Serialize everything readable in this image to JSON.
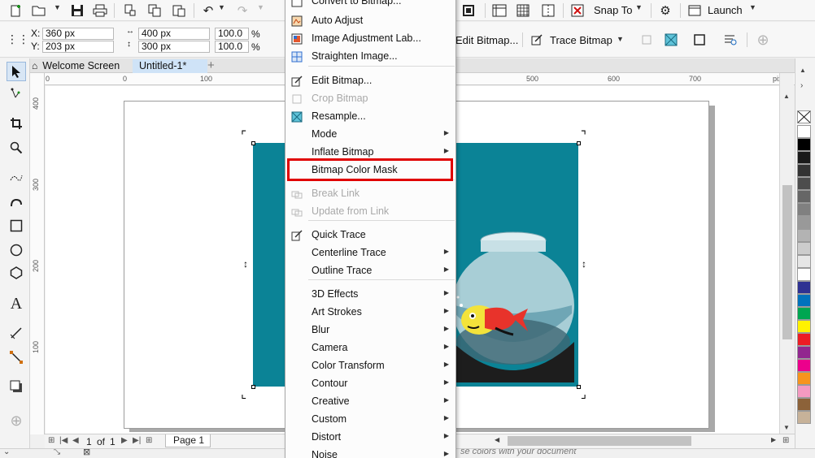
{
  "toolbar": {
    "snap_label": "Snap To",
    "launch_label": "Launch"
  },
  "property_bar": {
    "x_label": "X:",
    "x_value": "360 px",
    "y_label": "Y:",
    "y_value": "203 px",
    "width_value": "400 px",
    "height_value": "300 px",
    "scale_x": "100.0",
    "scale_y": "100.0",
    "percent": "%",
    "edit_bitmap_label": "Edit Bitmap...",
    "trace_bitmap_label": "Trace Bitmap"
  },
  "tabs": [
    {
      "label": "Welcome Screen"
    },
    {
      "label": "Untitled-1*"
    }
  ],
  "ruler": {
    "units": "pixels",
    "h_ticks": [
      "0",
      "0",
      "100",
      "500",
      "600",
      "700"
    ],
    "v_ticks": [
      "400",
      "300",
      "200",
      "100"
    ]
  },
  "menu": {
    "items": [
      {
        "label": "Convert to Bitmap...",
        "disabled": false,
        "submenu": false,
        "icon": "convert-bitmap-icon"
      },
      {
        "label": "Auto Adjust",
        "disabled": false,
        "submenu": false,
        "icon": "auto-adjust-icon"
      },
      {
        "label": "Image Adjustment Lab...",
        "disabled": false,
        "submenu": false,
        "icon": "image-adjustment-icon"
      },
      {
        "label": "Straighten Image...",
        "disabled": false,
        "submenu": false,
        "icon": "straighten-icon"
      },
      {
        "label": "Edit Bitmap...",
        "disabled": false,
        "submenu": false,
        "icon": "edit-bitmap-icon"
      },
      {
        "label": "Crop Bitmap",
        "disabled": true,
        "submenu": false,
        "icon": "crop-bitmap-icon"
      },
      {
        "label": "Resample...",
        "disabled": false,
        "submenu": false,
        "icon": "resample-icon"
      },
      {
        "label": "Mode",
        "disabled": false,
        "submenu": true,
        "icon": ""
      },
      {
        "label": "Inflate Bitmap",
        "disabled": false,
        "submenu": true,
        "icon": ""
      },
      {
        "label": "Bitmap Color Mask",
        "disabled": false,
        "submenu": false,
        "icon": ""
      },
      {
        "label": "Break Link",
        "disabled": true,
        "submenu": false,
        "icon": "break-link-icon"
      },
      {
        "label": "Update from Link",
        "disabled": true,
        "submenu": false,
        "icon": "update-link-icon"
      },
      {
        "label": "Quick Trace",
        "disabled": false,
        "submenu": false,
        "icon": "quick-trace-icon"
      },
      {
        "label": "Centerline Trace",
        "disabled": false,
        "submenu": true,
        "icon": ""
      },
      {
        "label": "Outline Trace",
        "disabled": false,
        "submenu": true,
        "icon": ""
      },
      {
        "label": "3D Effects",
        "disabled": false,
        "submenu": true,
        "icon": ""
      },
      {
        "label": "Art Strokes",
        "disabled": false,
        "submenu": true,
        "icon": ""
      },
      {
        "label": "Blur",
        "disabled": false,
        "submenu": true,
        "icon": ""
      },
      {
        "label": "Camera",
        "disabled": false,
        "submenu": true,
        "icon": ""
      },
      {
        "label": "Color Transform",
        "disabled": false,
        "submenu": true,
        "icon": ""
      },
      {
        "label": "Contour",
        "disabled": false,
        "submenu": true,
        "icon": ""
      },
      {
        "label": "Creative",
        "disabled": false,
        "submenu": true,
        "icon": ""
      },
      {
        "label": "Custom",
        "disabled": false,
        "submenu": true,
        "icon": ""
      },
      {
        "label": "Distort",
        "disabled": false,
        "submenu": true,
        "icon": ""
      },
      {
        "label": "Noise",
        "disabled": false,
        "submenu": true,
        "icon": ""
      }
    ],
    "highlighted": "Bitmap Color Mask"
  },
  "page_nav": {
    "current": "1",
    "of_label": "of",
    "total": "1",
    "page_tab": "Page 1"
  },
  "status": {
    "hint": "se colors with your document"
  },
  "colors": {
    "bitmap_bg": "#0b8396",
    "highlight_border": "#e00000",
    "palette": [
      "#ffffff",
      "#000000",
      "#1a1a1a",
      "#333333",
      "#4d4d4d",
      "#666666",
      "#808080",
      "#999999",
      "#b3b3b3",
      "#cccccc",
      "#e6e6e6",
      "#ffffff",
      "#2e3192",
      "#0072bc",
      "#00a651",
      "#fff200",
      "#ed1c24",
      "#92278f",
      "#ec008c",
      "#f7941d",
      "#f49ac1",
      "#8c6239",
      "#c7b299"
    ]
  }
}
